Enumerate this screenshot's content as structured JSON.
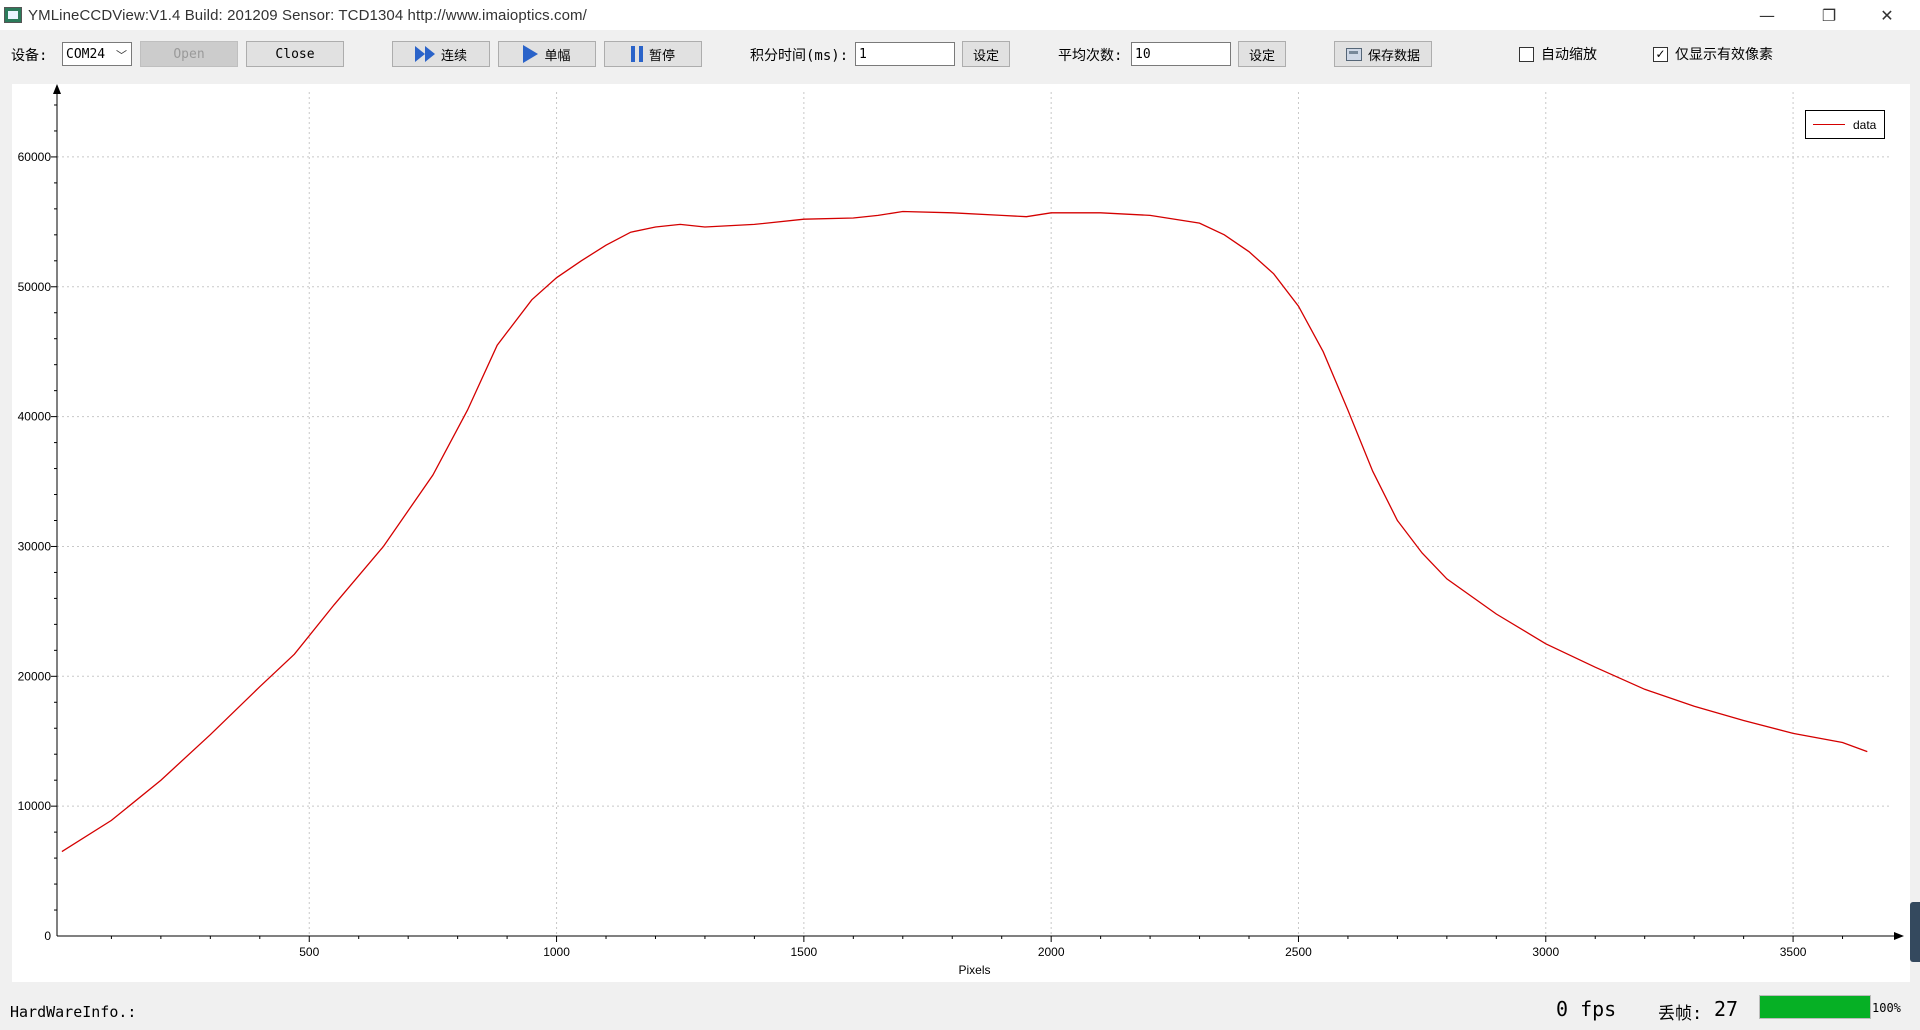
{
  "window": {
    "title": "YMLineCCDView:V1.4   Build: 201209   Sensor: TCD1304    http://www.imaioptics.com/",
    "minimize_glyph": "—",
    "restore_glyph": "❐",
    "close_glyph": "✕"
  },
  "toolbar": {
    "device_label": "设备:",
    "device_value": "COM24",
    "open_label": "Open",
    "close_label": "Close",
    "continuous_label": "连续",
    "single_label": "单幅",
    "pause_label": "暂停",
    "integration_label": "积分时间(ms):",
    "integration_value": "1",
    "set_label_1": "设定",
    "average_label": "平均次数:",
    "average_value": "10",
    "set_label_2": "设定",
    "save_label": "保存数据",
    "autoscale_label": "自动缩放",
    "autoscale_checked": false,
    "valid_pixels_label": "仅显示有效像素",
    "valid_pixels_checked": true
  },
  "chart_data": {
    "type": "line",
    "title": "",
    "xlabel": "Pixels",
    "ylabel": "",
    "xlim": [
      -10,
      3700
    ],
    "ylim": [
      0,
      65000
    ],
    "xticks": [
      500,
      1000,
      1500,
      2000,
      2500,
      3000,
      3500
    ],
    "yticks": [
      0,
      10000,
      20000,
      30000,
      40000,
      50000,
      60000
    ],
    "grid": true,
    "legend_position": "top-right",
    "series": [
      {
        "name": "data",
        "color": "#d40000",
        "x": [
          0,
          100,
          200,
          300,
          400,
          470,
          550,
          650,
          750,
          820,
          880,
          950,
          1000,
          1050,
          1100,
          1150,
          1200,
          1250,
          1300,
          1400,
          1500,
          1600,
          1650,
          1700,
          1800,
          1900,
          1950,
          2000,
          2100,
          2200,
          2300,
          2350,
          2400,
          2450,
          2500,
          2550,
          2600,
          2650,
          2700,
          2750,
          2800,
          2900,
          3000,
          3100,
          3200,
          3300,
          3400,
          3500,
          3600,
          3650
        ],
        "y": [
          6500,
          8900,
          12000,
          15500,
          19200,
          21700,
          25500,
          30000,
          35500,
          40500,
          45500,
          49000,
          50700,
          52000,
          53200,
          54200,
          54600,
          54800,
          54600,
          54800,
          55200,
          55300,
          55500,
          55800,
          55700,
          55500,
          55400,
          55700,
          55700,
          55500,
          54900,
          54000,
          52700,
          51000,
          48500,
          45000,
          40500,
          35800,
          32000,
          29500,
          27500,
          24800,
          22500,
          20700,
          19000,
          17700,
          16600,
          15600,
          14900,
          14200
        ]
      }
    ]
  },
  "status": {
    "hardware_label": "HardWareInfo.:",
    "fps_text": "0 fps",
    "dropped_label": "丢帧:",
    "dropped_count": "27",
    "progress_percent": 100,
    "progress_text": "100%"
  }
}
